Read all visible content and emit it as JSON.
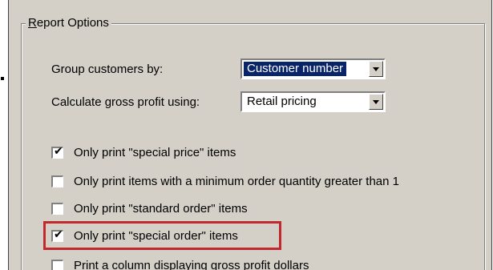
{
  "group_title": {
    "accel": "R",
    "rest": "eport Options"
  },
  "group_by": {
    "label": "Group customers by:",
    "value": "Customer number"
  },
  "gross_profit": {
    "label": "Calculate gross profit using:",
    "value": "Retail pricing"
  },
  "checkboxes": [
    {
      "label": "Only print \"special price\" items",
      "checked": true,
      "mark": "✔"
    },
    {
      "label": "Only print items with a minimum order quantity greater than 1",
      "checked": false,
      "mark": ""
    },
    {
      "label": "Only print \"standard order\" items",
      "checked": false,
      "mark": ""
    },
    {
      "label": "Only print \"special order\" items",
      "checked": true,
      "mark": "✔"
    },
    {
      "label": "Print a column displaying gross profit dollars",
      "checked": false,
      "mark": ""
    }
  ],
  "colors": {
    "dialog": "#d4d0c8",
    "selection": "#0a246a",
    "callout": "#c0282d"
  }
}
